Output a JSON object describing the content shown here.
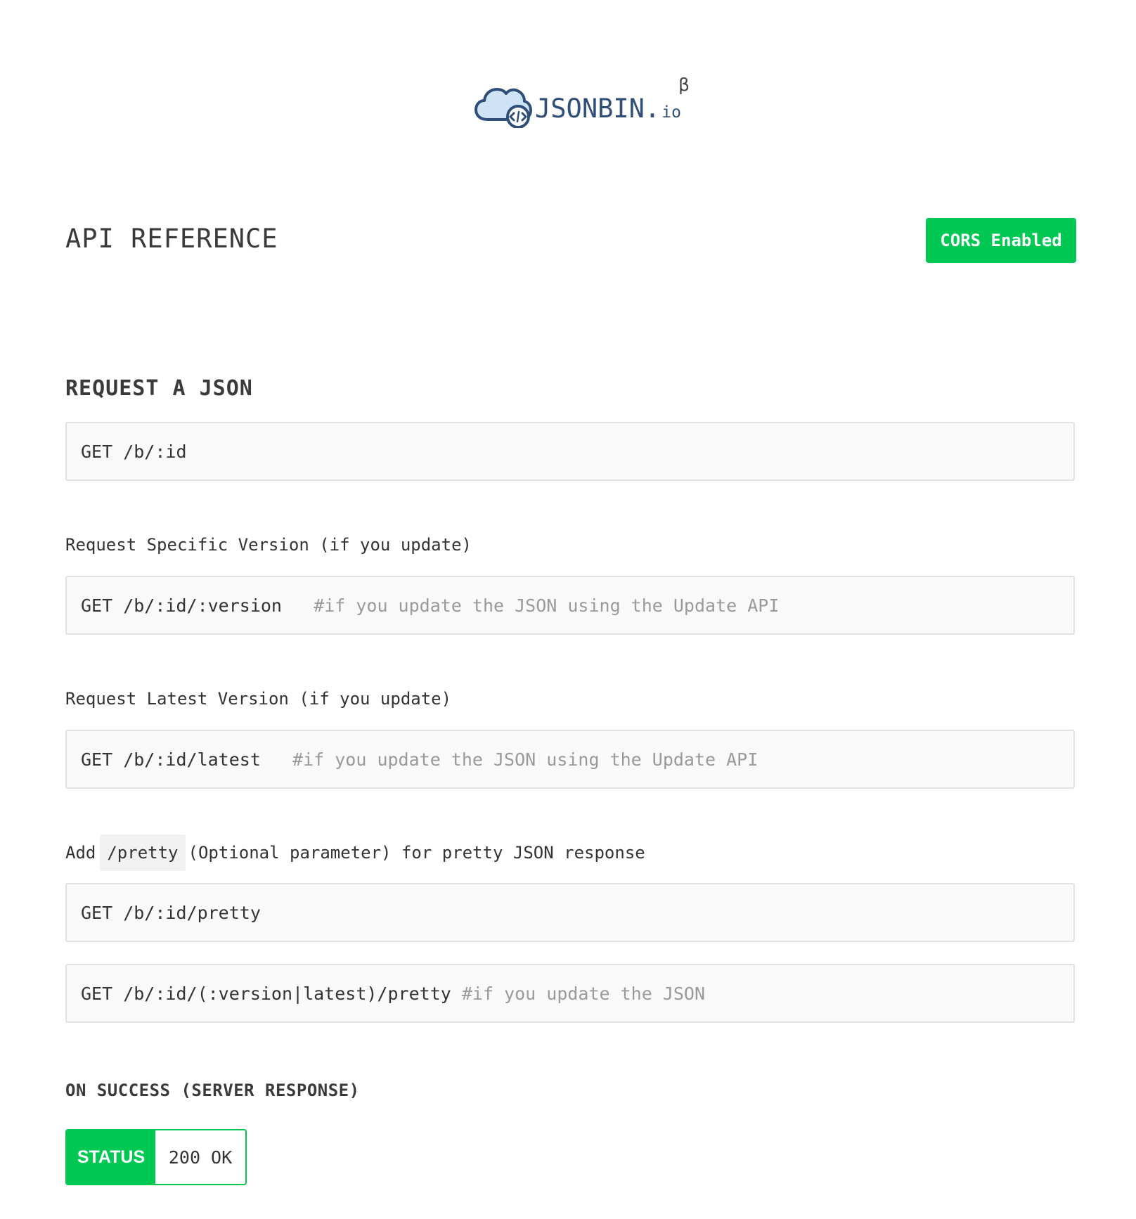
{
  "logo": {
    "name": "JSONBIN.",
    "tld": "io",
    "beta": "β",
    "brand_color": "#2f4f79",
    "icon": "cloud-code-icon"
  },
  "header": {
    "title": "API REFERENCE",
    "cors_badge": "CORS Enabled",
    "accent_color": "#00c853"
  },
  "request_section": {
    "title": "REQUEST A JSON",
    "basic": {
      "code": "GET /b/:id"
    },
    "specific_version": {
      "label": "Request Specific Version (if you update)",
      "code": "GET /b/:id/:version",
      "comment": "#if you update the JSON using the Update API"
    },
    "latest_version": {
      "label": "Request Latest Version (if you update)",
      "code": "GET /b/:id/latest",
      "comment": "#if you update the JSON using the Update API"
    },
    "pretty": {
      "label_prefix": "Add",
      "label_code": "/pretty",
      "label_suffix": "(Optional parameter) for pretty JSON response",
      "code_1": "GET /b/:id/pretty",
      "code_2": "GET /b/:id/(:version|latest)/pretty",
      "comment_2": "#if you update the JSON"
    }
  },
  "success_section": {
    "title": "ON SUCCESS (SERVER RESPONSE)",
    "status_label": "STATUS",
    "status_value": "200 OK"
  }
}
